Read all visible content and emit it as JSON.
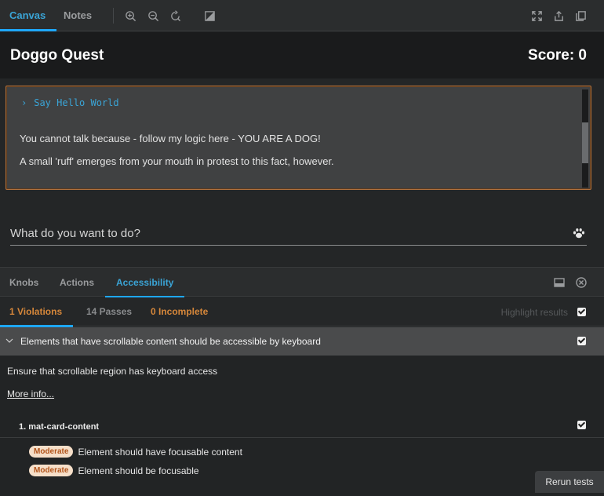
{
  "toolbar": {
    "tabs": [
      {
        "label": "Canvas",
        "active": true
      },
      {
        "label": "Notes",
        "active": false
      }
    ],
    "tool_icons": [
      "zoom-in-icon",
      "zoom-out-icon",
      "reset-zoom-icon",
      "background-toggle-icon"
    ],
    "right_icons": [
      "fullscreen-icon",
      "share-icon",
      "copy-icon"
    ]
  },
  "game": {
    "title": "Doggo Quest",
    "score_label": "Score: 0",
    "story": {
      "command": "Say Hello World",
      "lines": [
        "You cannot talk because - follow my logic here - YOU ARE A DOG!",
        "A small 'ruff' emerges from your mouth in protest to this fact, however."
      ]
    },
    "input": {
      "placeholder": "What do you want to do?",
      "value": ""
    }
  },
  "addon_panel": {
    "tabs": [
      {
        "label": "Knobs",
        "active": false
      },
      {
        "label": "Actions",
        "active": false
      },
      {
        "label": "Accessibility",
        "active": true
      }
    ]
  },
  "a11y": {
    "tabs": {
      "violations": "1 Violations",
      "passes": "14 Passes",
      "incomplete": "0 Incomplete"
    },
    "highlight_label": "Highlight results",
    "rule": {
      "title": "Elements that have scrollable content should be accessible by keyboard",
      "description": "Ensure that scrollable region has keyboard access",
      "more_info": "More info...",
      "node": "1. mat-card-content",
      "issues": [
        {
          "impact": "Moderate",
          "text": "Element should have focusable content"
        },
        {
          "impact": "Moderate",
          "text": "Element should be focusable"
        }
      ]
    },
    "rerun_label": "Rerun tests"
  },
  "colors": {
    "accent": "#1ea7fd",
    "violation": "#d6873a",
    "card_border": "#b0703c"
  }
}
